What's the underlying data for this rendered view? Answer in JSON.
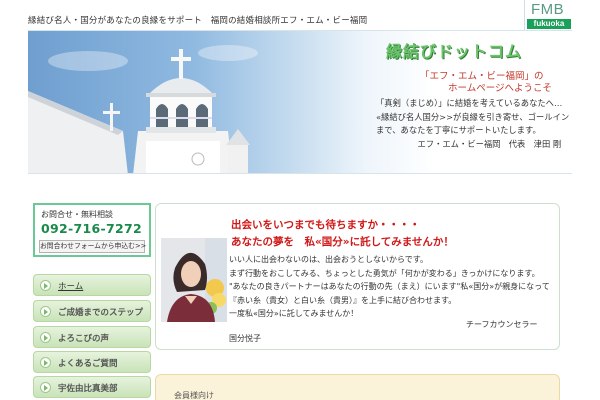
{
  "header": {
    "tagline": "縁結び名人・国分があなたの良縁をサポート　福岡の結婚相談所エフ・エム・ビー福岡",
    "logo_top": "FMB",
    "logo_bottom": "fukuoka"
  },
  "hero": {
    "title": "縁結びドットコム",
    "subtitle_line1": "「エフ・エム・ビー福岡」の",
    "subtitle_line2": "ホームページへようこそ",
    "text": "「真剣（まじめ）」に結婚を考えているあなたへ…\n«縁結び名人国分>>が良縁を引き寄せ、ゴールインまで、あなたを丁寧にサポートいたします。\n　　　　　エフ・エム・ビー福岡　代表　津田 剛"
  },
  "contact": {
    "heading": "お問合せ・無料相談",
    "phone": "092-716-7272",
    "form_button": "お問合わせフォームから申込む>>"
  },
  "nav": {
    "items": [
      {
        "label": "ホーム"
      },
      {
        "label": "ご成婚までのステップ"
      },
      {
        "label": "よろこびの声"
      },
      {
        "label": "よくあるご質問"
      },
      {
        "label": "宇佐由比真美部"
      }
    ]
  },
  "main_card": {
    "heading1": "出会いをいつまでも待ちますか・・・・",
    "heading2": "あなたの夢を　私«国分»に託してみませんか！",
    "body": "いい人に出会わないのは、出会おうとしないからです。\nまず行動をおこしてみる、ちょっとした勇気が「何かが変わる」きっかけになります。\n\"あなたの良きパートナーはあなたの行動の先（まえ）にいます\"私«国分»が親身になって『赤い糸（貴女）と白い糸（貴男）』を上手に結び合わせます。\n一度私«国分»に託してみませんか！",
    "sign_title": "チーフカウンセラー",
    "sign_name": "国分悦子"
  },
  "members": {
    "label": "会員様向け"
  }
}
